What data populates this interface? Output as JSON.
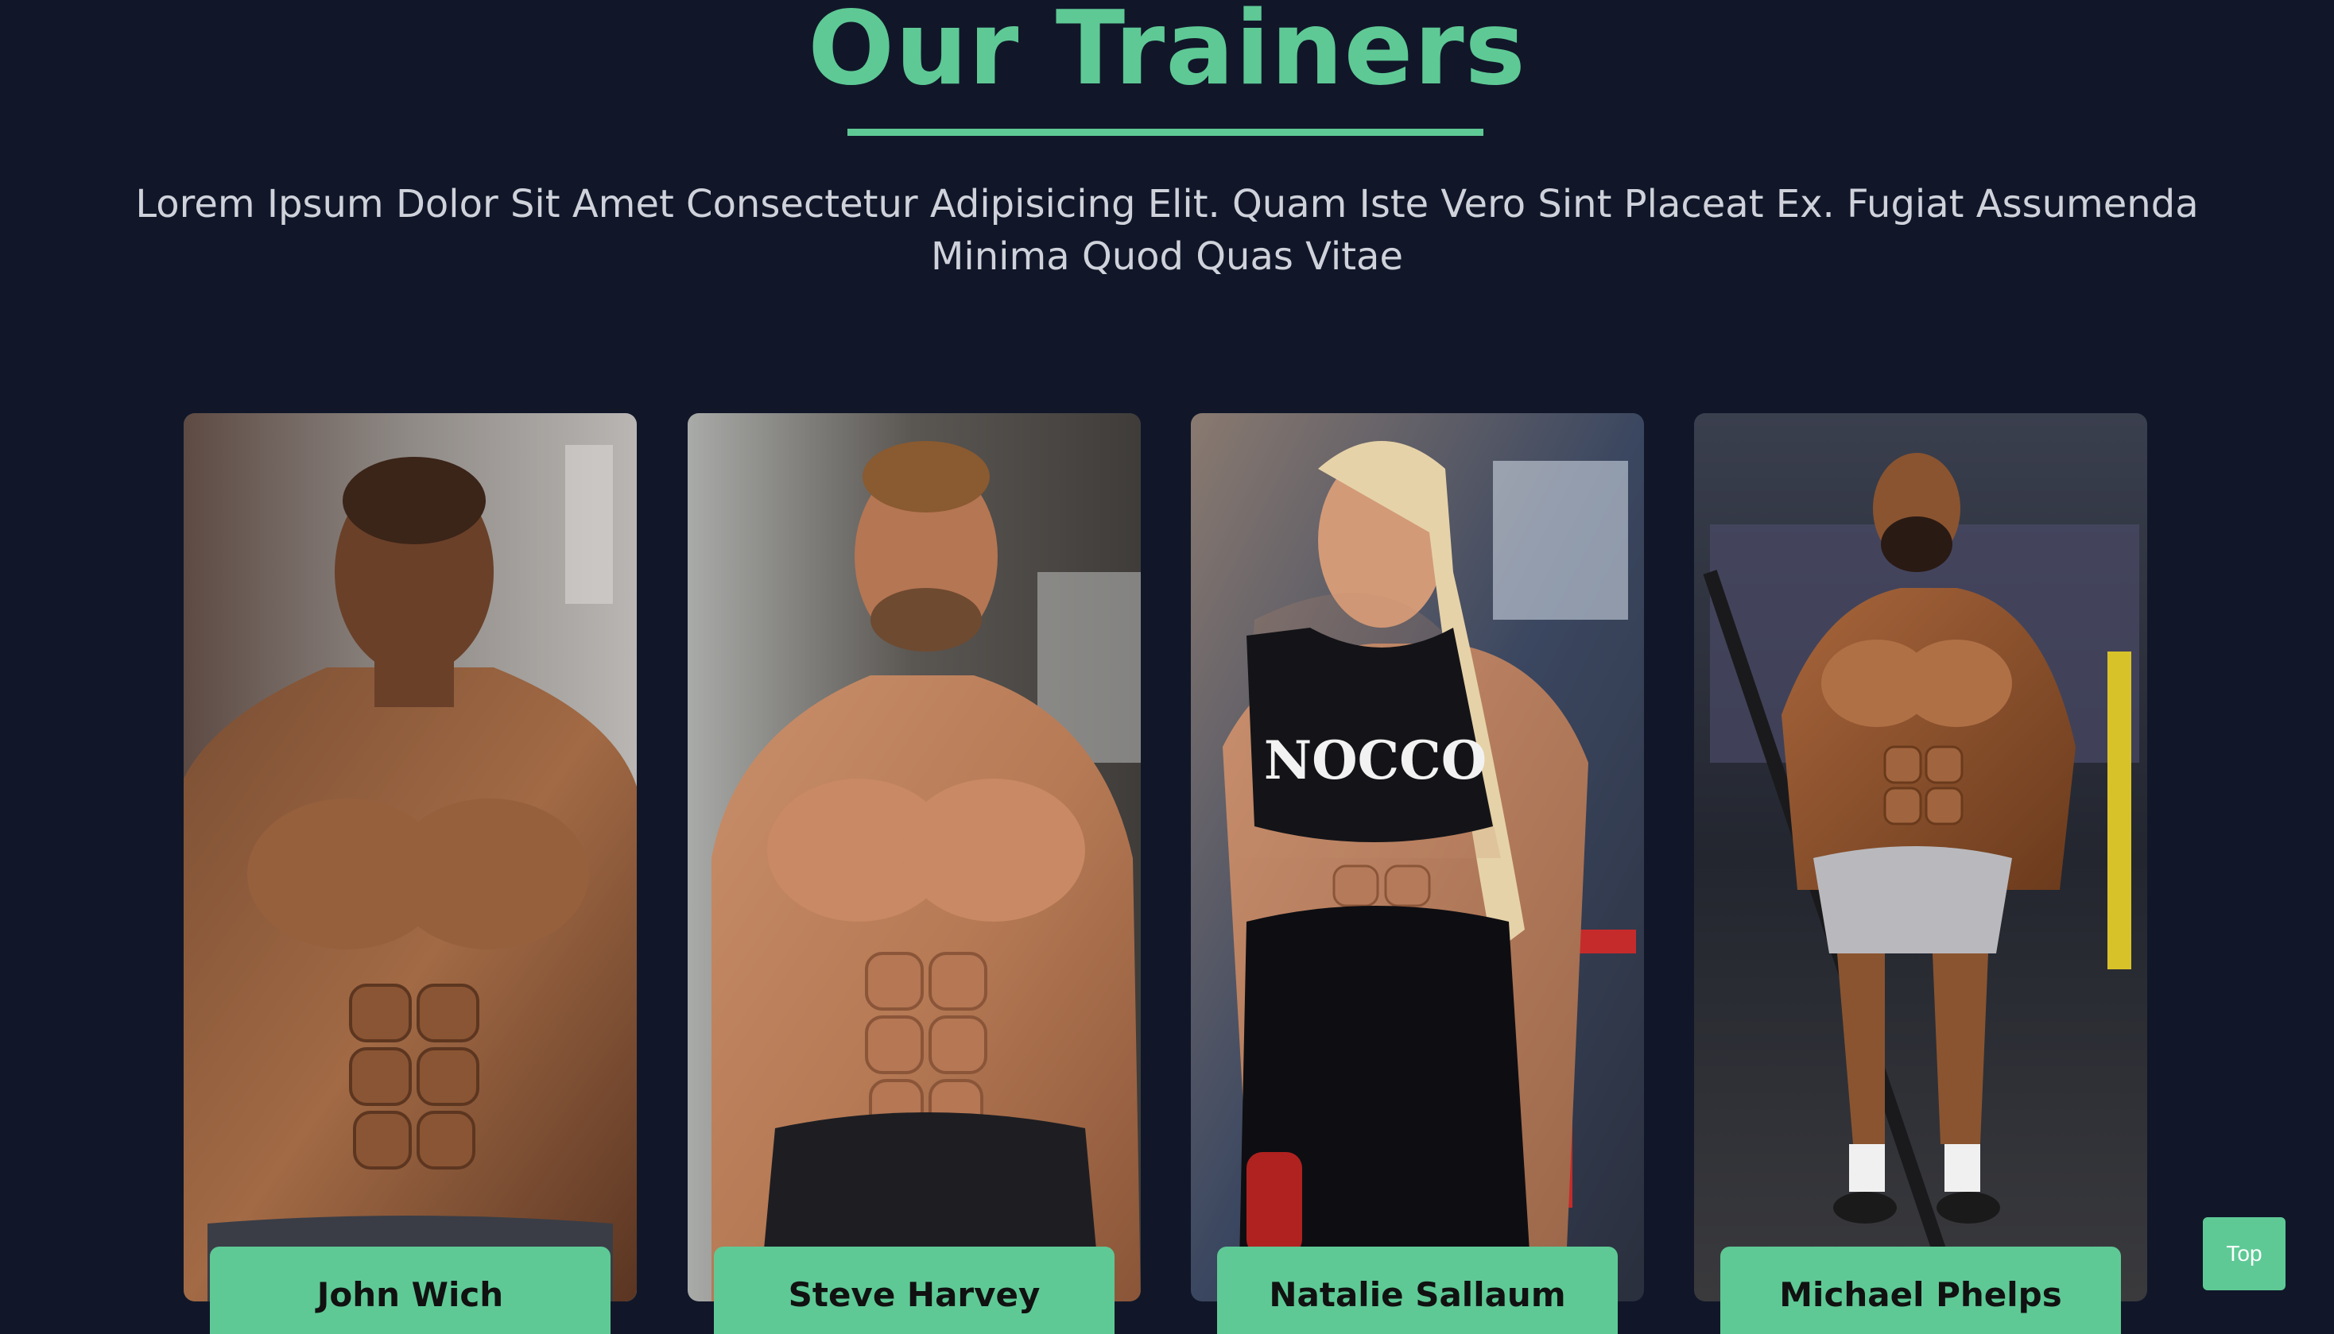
{
  "section": {
    "title": "Our Trainers",
    "subtitle": "Lorem Ipsum Dolor Sit Amet Consectetur Adipisicing Elit. Quam Iste Vero Sint Placeat Ex. Fugiat Assumenda Minima Quod Quas Vitae"
  },
  "trainers": [
    {
      "name": "John Wich"
    },
    {
      "name": "Steve Harvey"
    },
    {
      "name": "Natalie Sallaum",
      "shirt_text": "NOCCO"
    },
    {
      "name": "Michael Phelps"
    }
  ],
  "top_button": {
    "label": "Top"
  },
  "colors": {
    "background": "#111729",
    "accent": "#5ec995",
    "subtitle": "#cfd2da"
  }
}
